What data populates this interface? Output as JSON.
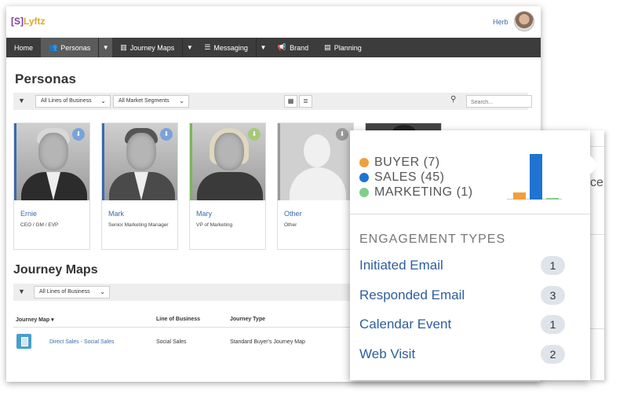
{
  "app": {
    "logo_bracket": "[S]",
    "logo_text": "Lyftz",
    "user": "Herb"
  },
  "nav": {
    "home": "Home",
    "personas": "Personas",
    "journey_maps": "Journey Maps",
    "messaging": "Messaging",
    "brand": "Brand",
    "planning": "Planning"
  },
  "personas": {
    "title": "Personas",
    "filter_business": "All Lines of Business",
    "filter_segments": "All Market Segments",
    "search_placeholder": "Search...",
    "cards": [
      {
        "name": "Ernie",
        "role": "CEO / GM / EVP"
      },
      {
        "name": "Mark",
        "role": "Senior Marketing Manager"
      },
      {
        "name": "Mary",
        "role": "VP of Marketing"
      },
      {
        "name": "Other",
        "role": "Other"
      }
    ]
  },
  "journey": {
    "title": "Journey Maps",
    "filter_business": "All Lines of Business",
    "columns": [
      "Journey Map ▾",
      "Line of Business",
      "Journey Type"
    ],
    "rows": [
      {
        "map": "Direct Sales - Social Sales",
        "business": "Social Sales",
        "type": "Standard Buyer's Journey Map"
      }
    ]
  },
  "popover": {
    "legend": [
      {
        "label": "BUYER (7)",
        "color": "#f0a03c",
        "value": 7
      },
      {
        "label": "SALES (45)",
        "color": "#1e74d0",
        "value": 45
      },
      {
        "label": "MARKETING (1)",
        "color": "#7fcf8a",
        "value": 1
      }
    ],
    "engagement_title": "ENGAGEMENT TYPES",
    "engagement": [
      {
        "label": "Initiated Email",
        "count": "1"
      },
      {
        "label": "Responded Email",
        "count": "3"
      },
      {
        "label": "Calendar Event",
        "count": "1"
      },
      {
        "label": "Web Visit",
        "count": "2"
      }
    ]
  },
  "side": {
    "text": "ce"
  }
}
